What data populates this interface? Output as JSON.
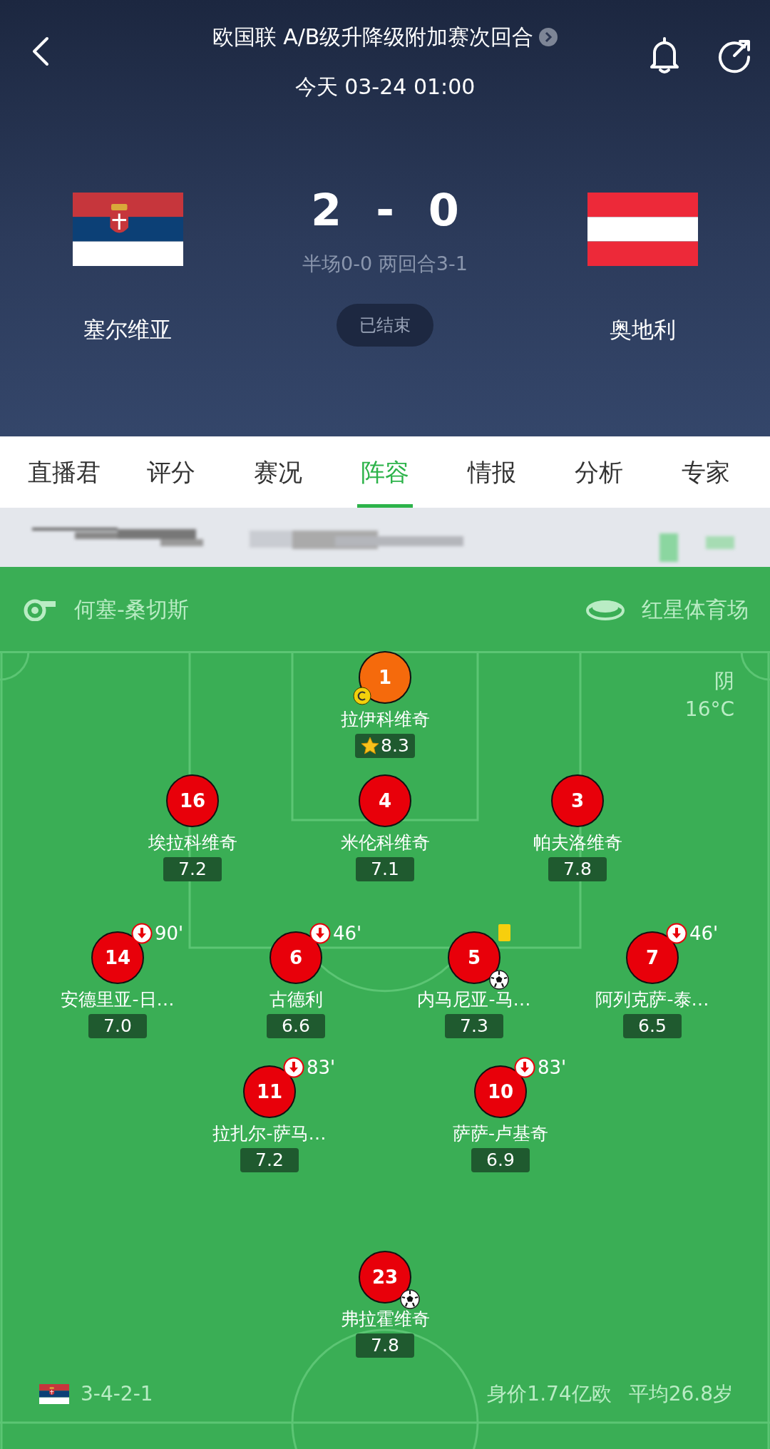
{
  "header": {
    "competition": "欧国联 A/B级升降级附加赛次回合",
    "datetime": "今天 03-24 01:00",
    "home": {
      "name": "塞尔维亚"
    },
    "away": {
      "name": "奥地利"
    },
    "home_score": "2",
    "separator": "-",
    "away_score": "0",
    "subscore": "半场0-0 两回合3-1",
    "status": "已结束"
  },
  "tabs": [
    {
      "label": "直播君",
      "selected": false
    },
    {
      "label": "评分",
      "selected": false
    },
    {
      "label": "赛况",
      "selected": false
    },
    {
      "label": "阵容",
      "selected": true
    },
    {
      "label": "情报",
      "selected": false
    },
    {
      "label": "分析",
      "selected": false
    },
    {
      "label": "专家",
      "selected": false
    }
  ],
  "pitch": {
    "referee": "何塞-桑切斯",
    "stadium": "红星体育场",
    "weather": "阴",
    "temperature": "16°C",
    "lines": [
      [
        {
          "number": "1",
          "name": "拉伊科维奇",
          "rating": "8.3",
          "kind": "goalkeeper",
          "captain": true,
          "best": true,
          "yellow_card": false,
          "goal": false
        }
      ],
      [
        {
          "number": "16",
          "name": "埃拉科维奇",
          "rating": "7.2",
          "kind": "outfield",
          "captain": false,
          "best": false,
          "yellow_card": false,
          "goal": false
        },
        {
          "number": "4",
          "name": "米伦科维奇",
          "rating": "7.1",
          "kind": "outfield",
          "captain": false,
          "best": false,
          "yellow_card": false,
          "goal": false
        },
        {
          "number": "3",
          "name": "帕夫洛维奇",
          "rating": "7.8",
          "kind": "outfield",
          "captain": false,
          "best": false,
          "yellow_card": false,
          "goal": false
        }
      ],
      [
        {
          "number": "14",
          "name": "安德里亚-日…",
          "rating": "7.0",
          "kind": "outfield",
          "captain": false,
          "best": false,
          "yellow_card": false,
          "goal": false,
          "sub_minute": "90'"
        },
        {
          "number": "6",
          "name": "古德利",
          "rating": "6.6",
          "kind": "outfield",
          "captain": false,
          "best": false,
          "yellow_card": false,
          "goal": false,
          "sub_minute": "46'"
        },
        {
          "number": "5",
          "name": "内马尼亚-马…",
          "rating": "7.3",
          "kind": "outfield",
          "captain": false,
          "best": false,
          "yellow_card": true,
          "goal": true
        },
        {
          "number": "7",
          "name": "阿列克萨-泰…",
          "rating": "6.5",
          "kind": "outfield",
          "captain": false,
          "best": false,
          "yellow_card": false,
          "goal": false,
          "sub_minute": "46'"
        }
      ],
      [
        {
          "number": "11",
          "name": "拉扎尔-萨马…",
          "rating": "7.2",
          "kind": "outfield",
          "captain": false,
          "best": false,
          "yellow_card": false,
          "goal": false,
          "sub_minute": "83'"
        },
        {
          "number": "10",
          "name": "萨萨-卢基奇",
          "rating": "6.9",
          "kind": "outfield",
          "captain": false,
          "best": false,
          "yellow_card": false,
          "goal": false,
          "sub_minute": "83'"
        }
      ],
      [
        {
          "number": "23",
          "name": "弗拉霍维奇",
          "rating": "7.8",
          "kind": "outfield",
          "captain": false,
          "best": false,
          "yellow_card": false,
          "goal": true
        }
      ]
    ],
    "formation": "3-4-2-1",
    "market_value": "身价1.74亿欧",
    "average_age": "平均26.8岁"
  }
}
